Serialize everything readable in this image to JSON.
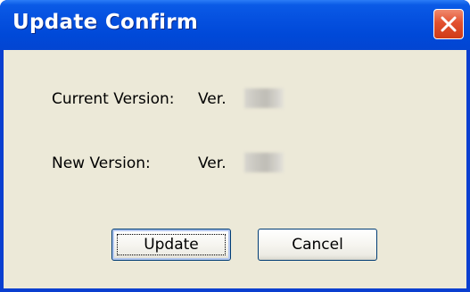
{
  "window": {
    "title": "Update Confirm"
  },
  "fields": {
    "current_label": "Current Version:",
    "current_value": "Ver.",
    "new_label": "New Version:",
    "new_value": "Ver."
  },
  "buttons": {
    "update_label": "Update",
    "cancel_label": "Cancel"
  },
  "colors": {
    "titlebar": "#0550df",
    "close_button": "#e2512f",
    "client_background": "#ece9d8"
  },
  "icons": {
    "close": "close-icon"
  }
}
